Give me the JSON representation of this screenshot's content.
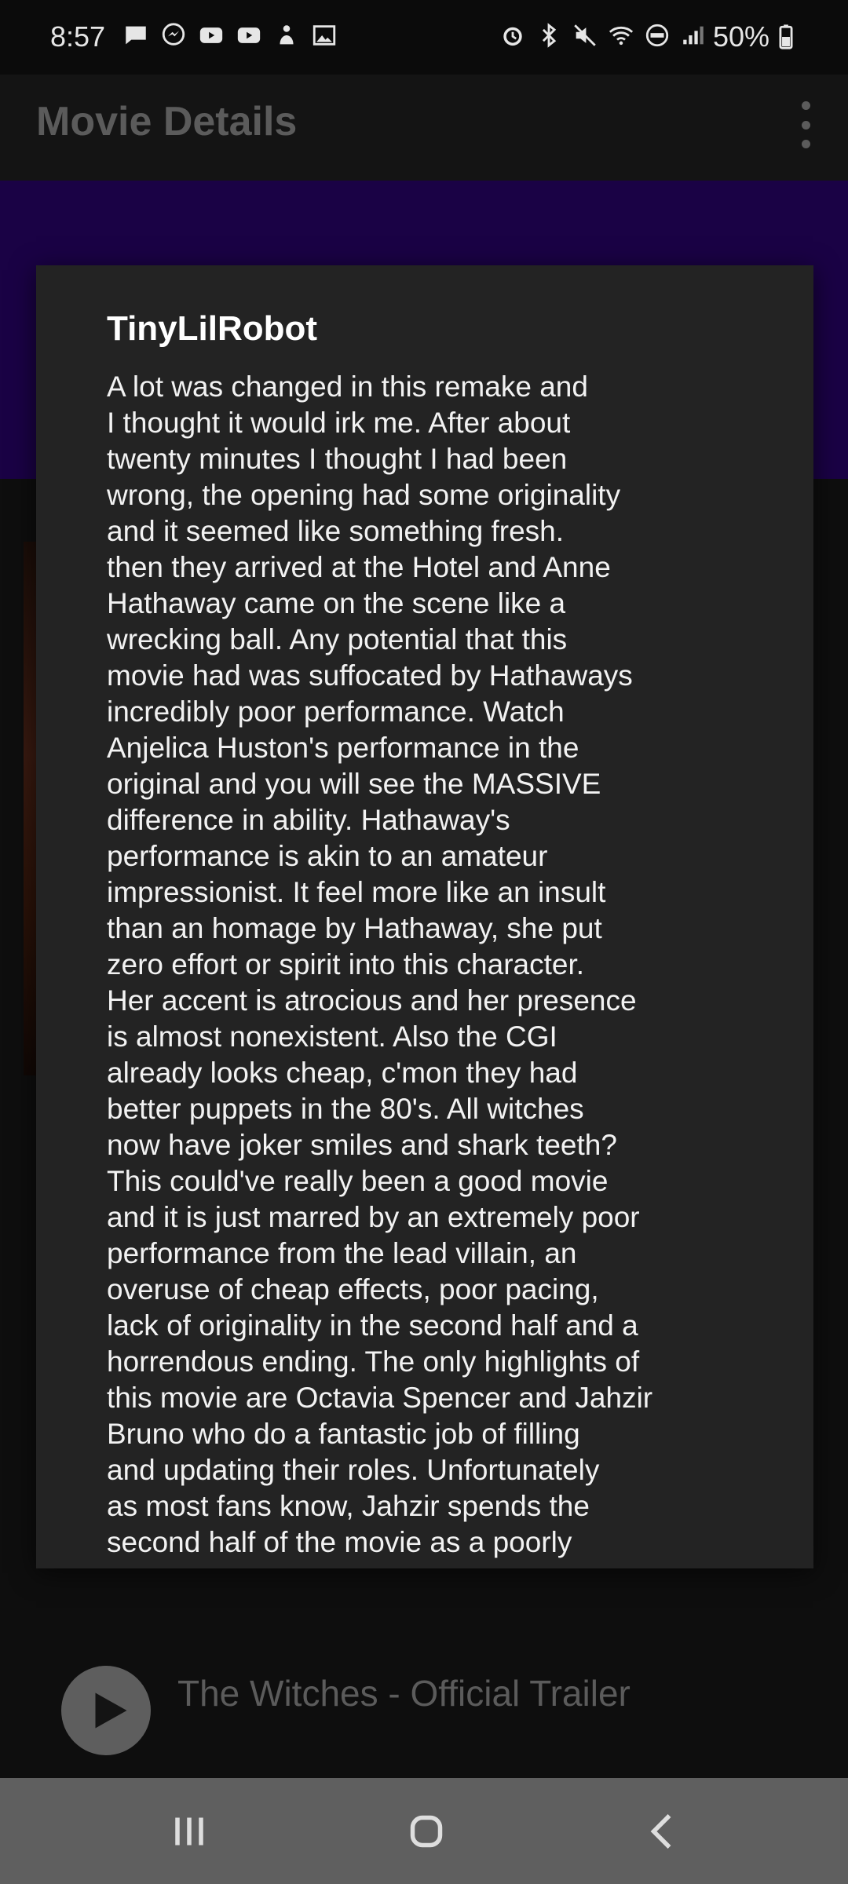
{
  "status_bar": {
    "time": "8:57",
    "battery": "50%",
    "left_icons": [
      "message-icon",
      "messenger-icon",
      "youtube-icon",
      "youtube-icon",
      "notification-icon",
      "image-icon"
    ],
    "right_icons": [
      "alarm-icon",
      "bluetooth-icon",
      "mute-icon",
      "wifi-icon",
      "volte-icon",
      "signal-icon"
    ]
  },
  "app_bar": {
    "title": "Movie Details"
  },
  "dialog": {
    "author": "TinyLilRobot",
    "review_lines": [
      "A lot was changed in this remake and",
      "I thought it would irk me. After about",
      "twenty minutes I thought I had been",
      "wrong, the opening had some originality",
      "and it seemed like something fresh.",
      "then they arrived at the Hotel and Anne",
      "Hathaway came on the scene like a",
      "wrecking ball. Any potential that this",
      "movie had was suffocated by Hathaways",
      "incredibly poor performance. Watch",
      "Anjelica Huston's performance in the",
      "original and you will see the MASSIVE",
      "difference in ability. Hathaway's",
      "performance is akin to an amateur",
      "impressionist. It feel more like an insult",
      "than an homage by Hathaway, she put",
      "zero effort or spirit into this character.",
      "Her accent is atrocious and her presence",
      "is almost nonexistent. Also the CGI",
      "already looks cheap, c'mon they had",
      "better puppets in the 80's. All witches",
      "now have joker smiles and shark teeth?",
      "This could've really been a good movie",
      "and it is just marred by an extremely poor",
      "performance from the lead villain, an",
      "overuse of cheap effects, poor pacing,",
      "lack of originality in the second half and a",
      "horrendous ending. The only highlights of",
      "this movie are Octavia Spencer and Jahzir",
      "Bruno who do a fantastic job of filling",
      "and updating their roles. Unfortunately",
      "as most fans know, Jahzir spends the",
      "second half of the movie as a poorly"
    ]
  },
  "trailer": {
    "title": "The Witches - Official Trailer",
    "play_icon": "play-icon"
  },
  "nav_bar": {
    "icons": [
      "recents-icon",
      "home-icon",
      "back-icon"
    ]
  },
  "colors": {
    "banner": "#1a0245",
    "dialog_bg": "#232323",
    "nav_bar": "#5f5f5f"
  }
}
